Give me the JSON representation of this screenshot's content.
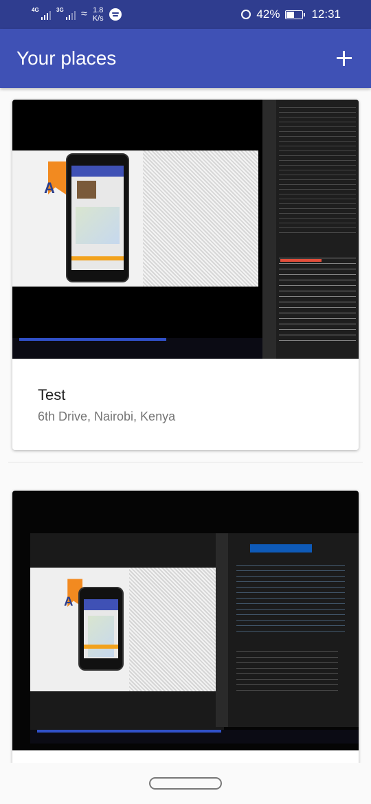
{
  "statusbar": {
    "network1": "4G",
    "network2": "3G",
    "speed_value": "1.8",
    "speed_unit": "K/s",
    "battery": "42%",
    "time": "12:31",
    "icons": [
      "signal-icon",
      "wifi-icon",
      "spotify-icon",
      "alarm-icon",
      "battery-icon"
    ]
  },
  "appbar": {
    "title": "Your places",
    "add_icon": "plus-icon",
    "color": "#3f51b5"
  },
  "places": [
    {
      "title": "Test",
      "address": "6th Drive, Nairobi, Kenya"
    },
    {
      "title": "",
      "address": ""
    }
  ],
  "photo_texts": {
    "logo_letter": "A"
  },
  "colors": {
    "statusbar": "#2f3d8f",
    "appbar": "#3f51b5",
    "background": "#fafafa"
  }
}
